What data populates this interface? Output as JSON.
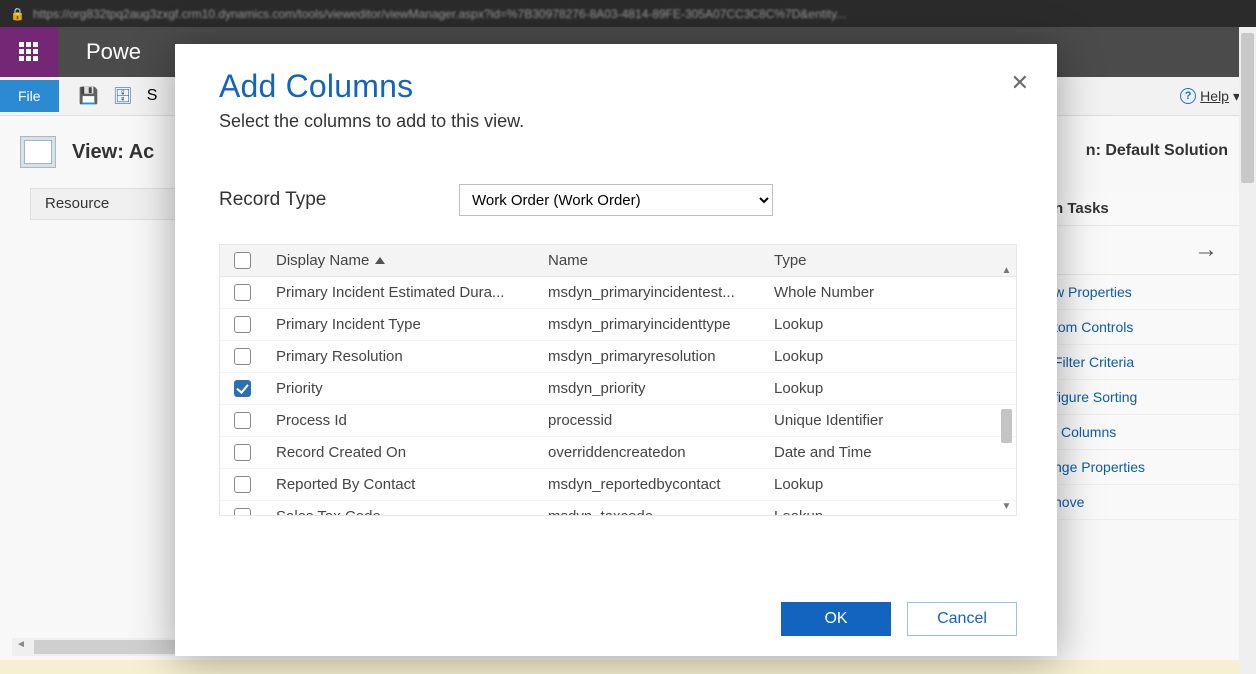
{
  "browser": {
    "url": "https://org832tpq2aug3zxgf.crm10.dynamics.com/tools/vieweditor/viewManager.aspx?id=%7B30978276-8A03-4814-89FE-305A07CC3C8C%7D&entity..."
  },
  "header": {
    "app_title": "Powe"
  },
  "ribbon": {
    "file_label": "File",
    "save_letter": "S",
    "help_label": "Help"
  },
  "background": {
    "view_title": "View: Ac",
    "solution_label": "n: Default Solution",
    "column_header": "Resource",
    "side_panel_title": "n Tasks",
    "side_links": {
      "view_properties": "w Properties",
      "custom_controls": "tom Controls",
      "filter_criteria": "Filter Criteria",
      "configure_sorting": "figure Sorting",
      "columns": "l Columns",
      "change_properties": "nge Properties",
      "remove": "nove"
    }
  },
  "modal": {
    "title": "Add Columns",
    "subtitle": "Select the columns to add to this view.",
    "record_type_label": "Record Type",
    "record_type_value": "Work Order (Work Order)",
    "grid_headers": {
      "display_name": "Display Name",
      "name": "Name",
      "type": "Type"
    },
    "rows": [
      {
        "display_name": "Primary Incident Estimated Dura...",
        "name": "msdyn_primaryincidentest...",
        "type": "Whole Number",
        "checked": false
      },
      {
        "display_name": "Primary Incident Type",
        "name": "msdyn_primaryincidenttype",
        "type": "Lookup",
        "checked": false
      },
      {
        "display_name": "Primary Resolution",
        "name": "msdyn_primaryresolution",
        "type": "Lookup",
        "checked": false
      },
      {
        "display_name": "Priority",
        "name": "msdyn_priority",
        "type": "Lookup",
        "checked": true
      },
      {
        "display_name": "Process Id",
        "name": "processid",
        "type": "Unique Identifier",
        "checked": false
      },
      {
        "display_name": "Record Created On",
        "name": "overriddencreatedon",
        "type": "Date and Time",
        "checked": false
      },
      {
        "display_name": "Reported By Contact",
        "name": "msdyn_reportedbycontact",
        "type": "Lookup",
        "checked": false
      },
      {
        "display_name": "Sales Tax Code",
        "name": "msdyn_taxcode",
        "type": "Lookup",
        "checked": false
      }
    ],
    "ok_label": "OK",
    "cancel_label": "Cancel"
  }
}
